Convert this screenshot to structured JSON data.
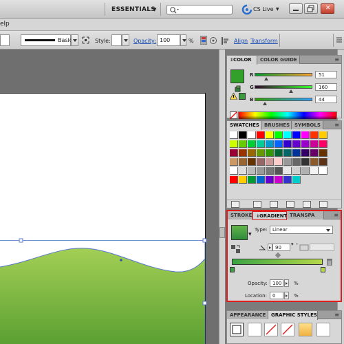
{
  "app_bar": {
    "workspace_label": "ESSENTIALS",
    "search_placeholder": "",
    "cs_live_label": "CS Live"
  },
  "menu_bar": {
    "partial_item": "elp"
  },
  "control_bar": {
    "stroke_profile_label": "Basic",
    "style_label": "Style:",
    "opacity_label": "Opacity:",
    "opacity_value": "100",
    "opacity_unit": "%",
    "align_label": "Align",
    "transform_label": "Transform"
  },
  "color_panel": {
    "tabs": [
      "COLOR",
      "COLOR GUIDE"
    ],
    "channels": [
      {
        "name": "R",
        "value": "51",
        "level": 0.2
      },
      {
        "name": "G",
        "value": "160",
        "level": 0.627
      },
      {
        "name": "B",
        "value": "44",
        "level": 0.173
      }
    ],
    "current_color": "#33a02c"
  },
  "swatches_panel": {
    "tabs": [
      "SWATCHES",
      "BRUSHES",
      "SYMBOLS"
    ],
    "rows": [
      [
        "#ffffff",
        "#000000",
        "#ffffff",
        "#ff0000",
        "#ffff00",
        "#00ff00",
        "#00ffff",
        "#0000ff",
        "#ff00ff",
        "#ff3300",
        "#ffcc00"
      ],
      [
        "#ccff00",
        "#66cc00",
        "#00cc33",
        "#00cc99",
        "#0099cc",
        "#0066ff",
        "#3300cc",
        "#6600cc",
        "#9900cc",
        "#cc0099",
        "#ff0066"
      ],
      [
        "#990033",
        "#993300",
        "#996600",
        "#669900",
        "#339900",
        "#006633",
        "#006666",
        "#003399",
        "#330066",
        "#660066",
        "#663300"
      ],
      [
        "#cc9966",
        "#996633",
        "#663300",
        "#996666",
        "#cc9999",
        "#ffcccc",
        "#999999",
        "#666666",
        "#333333",
        "#8b5a2b",
        "#5c3317"
      ],
      [
        "#ffffff",
        "#dddddd",
        "#bbbbbb",
        "#999999",
        "#777777",
        "#555555",
        "#e8e8e8",
        "#cfcfcf",
        "#b0b0b0",
        "#f2f2f2",
        "#ffffff"
      ],
      [
        "#ff0000",
        "#ffcc00",
        "#009933",
        "#0066cc",
        "#6600cc",
        "#cc00cc",
        "#3333cc",
        "#00cccc"
      ]
    ]
  },
  "gradient_panel": {
    "tabs": [
      "STROKE",
      "GRADIENT",
      "TRANSPA"
    ],
    "type_label": "Type:",
    "type_value": "Linear",
    "angle_value": "90",
    "angle_unit": "°",
    "stops": [
      {
        "color": "#3aa343",
        "location": 0
      },
      {
        "color": "#b6d94a",
        "location": 100
      }
    ],
    "opacity_label": "Opacity:",
    "opacity_value": "100",
    "location_label": "Location:",
    "location_value": "0",
    "unit": "%"
  },
  "appearance_panel": {
    "tabs": [
      "APPEARANCE",
      "GRAPHIC STYLES"
    ]
  },
  "artwork": {
    "fill_top": "#a3cf55",
    "fill_bottom": "#5ba032"
  }
}
